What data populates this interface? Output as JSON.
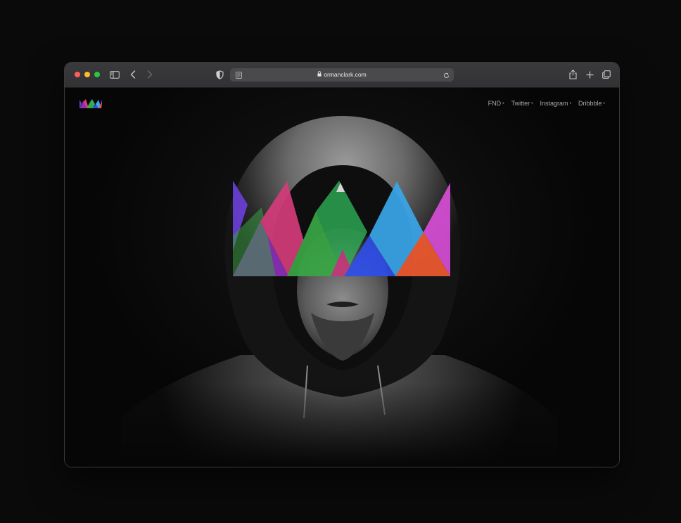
{
  "browser": {
    "url": "ormanclark.com"
  },
  "site": {
    "nav": [
      {
        "label": "FND",
        "marker": "•"
      },
      {
        "label": "Twitter",
        "marker": "•"
      },
      {
        "label": "Instagram",
        "marker": "•"
      },
      {
        "label": "Dribbble",
        "marker": "•"
      }
    ]
  },
  "colors": {
    "crown_purple": "#6a3fd6",
    "crown_violet": "#8b2fb8",
    "crown_magenta": "#d43c7a",
    "crown_green": "#3aa845",
    "crown_blue": "#2f6ee8",
    "crown_lightblue": "#3aa6ea",
    "crown_orange": "#f05a30",
    "crown_pink": "#d84ed6"
  },
  "icons": [
    "sidebar-icon",
    "back-icon",
    "forward-icon",
    "shield-icon",
    "reader-icon",
    "lock-icon",
    "reload-icon",
    "share-icon",
    "new-tab-icon",
    "tabs-overview-icon"
  ]
}
